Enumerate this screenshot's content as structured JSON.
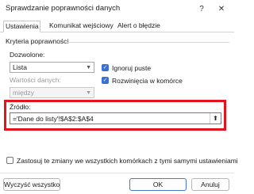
{
  "window": {
    "title": "Sprawdzanie poprawności danych",
    "help_glyph": "?",
    "close_glyph": "✕"
  },
  "tabs": [
    {
      "label": "Ustawienia",
      "active": true
    },
    {
      "label": "Komunikat wejściowy",
      "active": false
    },
    {
      "label": "Alert o błędzie",
      "active": false
    }
  ],
  "criteria": {
    "group_label": "Kryteria poprawności",
    "allow_label": "Dozwolone:",
    "allow_value": "Lista",
    "data_label": "Wartości danych:",
    "data_value": "między",
    "ignore_blank_label": "Ignoruj puste",
    "ignore_blank_checked": true,
    "dropdown_label": "Rozwinięcia w komórce",
    "dropdown_checked": true,
    "source_label": "Źródło:",
    "source_value": "='Dane do listy'!$A$2:$A$4"
  },
  "apply_all": {
    "label": "Zastosuj te zmiany we wszystkich komórkach z tymi samymi ustawieniami",
    "checked": false
  },
  "buttons": {
    "clear_all": "Wyczyść wszystko",
    "ok": "OK",
    "cancel": "Anuluj"
  },
  "colors": {
    "highlight": "#e3141c",
    "checkbox": "#3b6fd1"
  }
}
